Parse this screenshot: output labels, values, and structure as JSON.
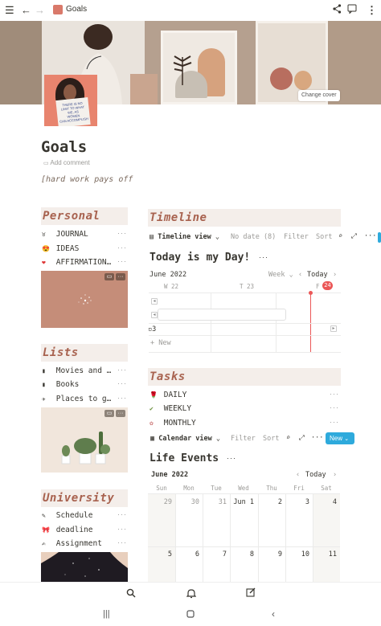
{
  "topbar": {
    "title": "Goals"
  },
  "cover": {
    "change_cover": "Change cover"
  },
  "page": {
    "title": "Goals",
    "add_comment": "Add comment",
    "quote": "[hard work pays off"
  },
  "personal": {
    "header": "Personal",
    "items": [
      {
        "emoji": "♉",
        "label": "JOURNAL"
      },
      {
        "emoji": "😍",
        "label": "IDEAS"
      },
      {
        "emoji": "❤",
        "label": "AFFIRMATION…"
      }
    ]
  },
  "lists": {
    "header": "Lists",
    "items": [
      {
        "emoji": "▮",
        "label": "Movies and …"
      },
      {
        "emoji": "▮",
        "label": "Books"
      },
      {
        "emoji": "✈",
        "label": "Places to g…"
      }
    ]
  },
  "university": {
    "header": "University",
    "items": [
      {
        "emoji": "✎",
        "label": "Schedule"
      },
      {
        "emoji": "🎀",
        "label": "deadline"
      },
      {
        "emoji": "✍",
        "label": "Assignment"
      }
    ]
  },
  "timeline": {
    "header": "Timeline",
    "view_label": "Timeline view",
    "no_date": "No date (8)",
    "filter": "Filter",
    "sort": "Sort",
    "db_title": "Today is my Day!",
    "month": "June 2022",
    "scale": "Week",
    "today": "Today",
    "day_w": "W 22",
    "day_t": "T 23",
    "day_f": "F",
    "today_num": "24",
    "row_label": "3",
    "new_label": "New"
  },
  "tasks": {
    "header": "Tasks",
    "items": [
      {
        "emoji": "🌹",
        "label": "DAILY"
      },
      {
        "emoji": "✔",
        "label": "WEEKLY"
      },
      {
        "emoji": "✿",
        "label": "MONTHLY"
      }
    ]
  },
  "calendar": {
    "view_label": "Calendar view",
    "filter": "Filter",
    "sort": "Sort",
    "new_label": "New",
    "db_title": "Life Events",
    "month": "June 2022",
    "today": "Today",
    "weekdays": [
      "Sun",
      "Mon",
      "Tue",
      "Wed",
      "Thu",
      "Fri",
      "Sat"
    ],
    "week1": [
      "29",
      "30",
      "31",
      "Jun 1",
      "2",
      "3",
      "4"
    ],
    "week2": [
      "5",
      "6",
      "7",
      "8",
      "9",
      "10",
      "11"
    ]
  },
  "colors": {
    "accent_header": "#a8624f",
    "section_bg": "#f4eeea",
    "new_button": "#2eaadc",
    "today_marker": "#eb5757"
  }
}
